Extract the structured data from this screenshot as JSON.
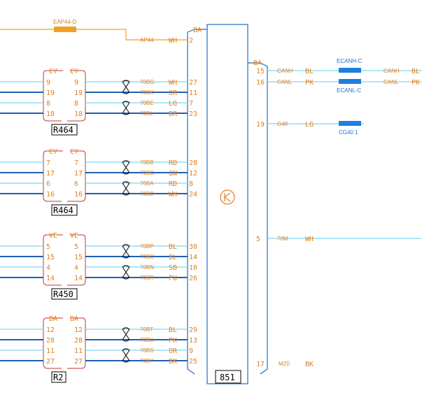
{
  "top_wire": {
    "fuse_label": "EAP44-D",
    "wire_label": "AP44",
    "color": "WH",
    "pin": "2"
  },
  "main_unit": {
    "label": "851",
    "left_connector": "BA",
    "right_connector": "BA"
  },
  "connectors": [
    {
      "header_left": "CY",
      "header_right": "CY",
      "name": "R464",
      "pins": [
        {
          "left": "9",
          "right": "9",
          "wire": "70BG",
          "color": "WH",
          "pin": "27"
        },
        {
          "left": "19",
          "right": "19",
          "wire": "70BK",
          "color": "OR",
          "pin": "11"
        },
        {
          "left": "8",
          "right": "8",
          "wire": "70BE",
          "color": "LG",
          "pin": "7"
        },
        {
          "left": "18",
          "right": "18",
          "wire": "70BL",
          "color": "BR",
          "pin": "23"
        }
      ]
    },
    {
      "header_left": "CY",
      "header_right": "CY",
      "name": "R464",
      "pins": [
        {
          "left": "7",
          "right": "7",
          "wire": "70BB",
          "color": "RD",
          "pin": "28"
        },
        {
          "left": "17",
          "right": "17",
          "wire": "70BC",
          "color": "GN",
          "pin": "12"
        },
        {
          "left": "6",
          "right": "6",
          "wire": "70BA",
          "color": "RD",
          "pin": "8"
        },
        {
          "left": "16",
          "right": "16",
          "wire": "70BD",
          "color": "WH",
          "pin": "24"
        }
      ]
    },
    {
      "header_left": "VE",
      "header_right": "VE",
      "name": "R450",
      "pins": [
        {
          "left": "5",
          "right": "5",
          "wire": "70BP",
          "color": "BL",
          "pin": "30"
        },
        {
          "left": "15",
          "right": "15",
          "wire": "70BO",
          "color": "BL",
          "pin": "14"
        },
        {
          "left": "4",
          "right": "4",
          "wire": "70BN",
          "color": "SB",
          "pin": "10"
        },
        {
          "left": "14",
          "right": "14",
          "wire": "70BR",
          "color": "PU",
          "pin": "26"
        }
      ]
    },
    {
      "header_left": "BA",
      "header_right": "BA",
      "name": "R2",
      "pins": [
        {
          "left": "12",
          "right": "12",
          "wire": "70BT",
          "color": "BL",
          "pin": "29"
        },
        {
          "left": "28",
          "right": "28",
          "wire": "70BU",
          "color": "PK",
          "pin": "13"
        },
        {
          "left": "11",
          "right": "11",
          "wire": "70BS",
          "color": "OR",
          "pin": "9"
        },
        {
          "left": "27",
          "right": "27",
          "wire": "70BY",
          "color": "BK",
          "pin": "25"
        }
      ]
    }
  ],
  "right_pins": [
    {
      "pin": "15",
      "wire": "CANH",
      "color": "BL",
      "splice": "ECANH-C",
      "out_wire": "CANH",
      "out_color": "BL"
    },
    {
      "pin": "16",
      "wire": "CANL",
      "color": "PK",
      "splice": "ECANL-C",
      "out_wire": "CANL",
      "out_color": "PK"
    },
    {
      "pin": "19",
      "wire": "G40",
      "color": "LG",
      "splice": "CG40 1"
    },
    {
      "pin": "5",
      "wire": "70M",
      "color": "WH"
    },
    {
      "pin": "17",
      "wire": "MZ0",
      "color": "BK"
    }
  ],
  "colors": {
    "wire_light": "#7fd6ef",
    "wire_dark": "#1e5fb5",
    "label": "#e0801e",
    "fuse": "#f0a020",
    "splice": "#1e7fe0",
    "box": "#1d6fc8"
  }
}
